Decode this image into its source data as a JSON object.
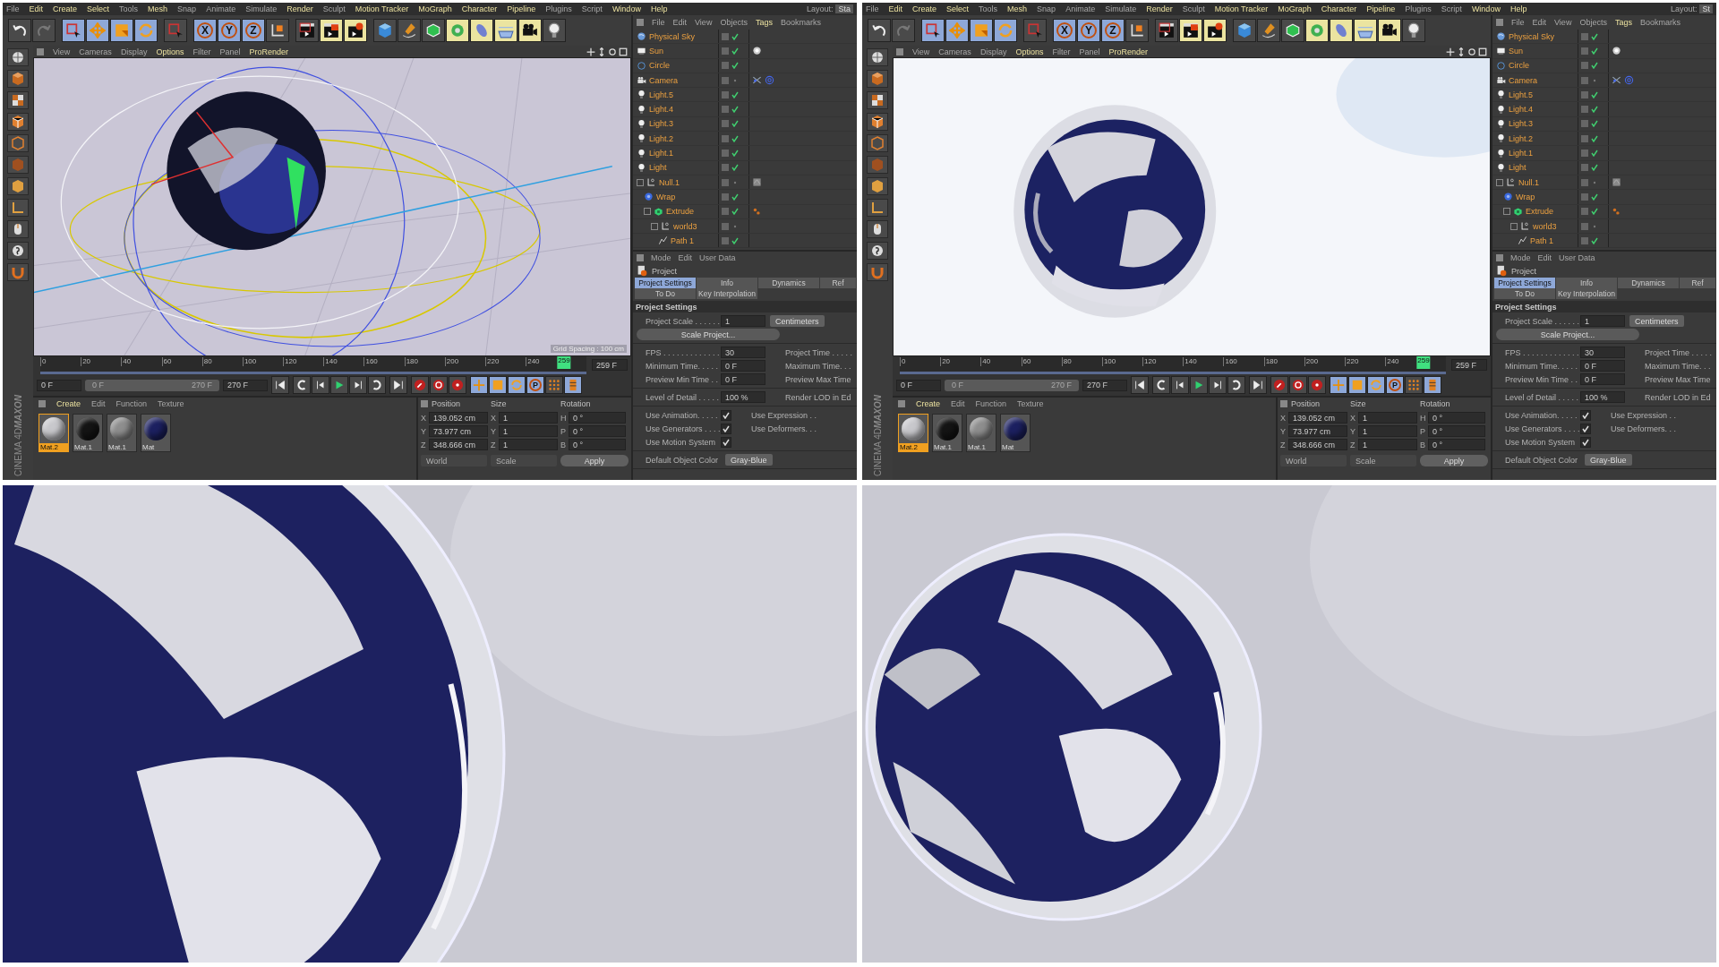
{
  "screens": [
    {
      "menu": [
        {
          "label": "File",
          "accent": false
        },
        {
          "label": "Edit",
          "accent": true
        },
        {
          "label": "Create",
          "accent": true
        },
        {
          "label": "Select",
          "accent": true
        },
        {
          "label": "Tools",
          "accent": false
        },
        {
          "label": "Mesh",
          "accent": true
        },
        {
          "label": "Snap",
          "accent": false
        },
        {
          "label": "Animate",
          "accent": false
        },
        {
          "label": "Simulate",
          "accent": false
        },
        {
          "label": "Render",
          "accent": true
        },
        {
          "label": "Sculpt",
          "accent": false
        },
        {
          "label": "Motion Tracker",
          "accent": true
        },
        {
          "label": "MoGraph",
          "accent": true
        },
        {
          "label": "Character",
          "accent": true
        },
        {
          "label": "Pipeline",
          "accent": true
        },
        {
          "label": "Plugins",
          "accent": false
        },
        {
          "label": "Script",
          "accent": false
        },
        {
          "label": "Window",
          "accent": true
        },
        {
          "label": "Help",
          "accent": true
        }
      ],
      "layout": {
        "label": "Layout:",
        "value": "Sta"
      },
      "axis_buttons": [
        "X",
        "Y",
        "Z"
      ],
      "viewport": {
        "kind": "wireframe",
        "grid_spacing": "Grid Spacing : 100 cm",
        "menu": [
          {
            "label": "View",
            "accent": false
          },
          {
            "label": "Cameras",
            "accent": false
          },
          {
            "label": "Display",
            "accent": false
          },
          {
            "label": "Options",
            "accent": true
          },
          {
            "label": "Filter",
            "accent": false
          },
          {
            "label": "Panel",
            "accent": false
          },
          {
            "label": "ProRender",
            "accent": true
          }
        ]
      },
      "timeline": {
        "ticks": [
          "0",
          "20",
          "40",
          "60",
          "80",
          "100",
          "120",
          "140",
          "160",
          "180",
          "200",
          "220",
          "240"
        ],
        "current": "259",
        "level": 0.959,
        "frame_field": "259 F"
      },
      "transport": {
        "start": "0 F",
        "range_start": "0 F",
        "range_end": "270 F",
        "end": "270 F",
        "key_button": "P",
        "level": 1
      },
      "materials": {
        "menu": [
          {
            "label": "Create",
            "accent": true
          },
          {
            "label": "Edit",
            "accent": false
          },
          {
            "label": "Function",
            "accent": false
          },
          {
            "label": "Texture",
            "accent": false
          }
        ],
        "items": [
          {
            "name": "Mat.2",
            "selected": true,
            "color": "#c8c8cc"
          },
          {
            "name": "Mat.1",
            "selected": false,
            "color": "#141414"
          },
          {
            "name": "Mat.1",
            "selected": false,
            "color": "#8e8e8e"
          },
          {
            "name": "Mat",
            "selected": false,
            "color": "#1c2060"
          }
        ]
      },
      "coords": {
        "headers": [
          "Position",
          "Size",
          "Rotation"
        ],
        "rows": [
          {
            "axis": "X",
            "position": "139.052 cm",
            "size_axis": "X",
            "size": "1",
            "rot_axis": "H",
            "rotation": "0 °"
          },
          {
            "axis": "Y",
            "position": "73.977 cm",
            "size_axis": "Y",
            "size": "1",
            "rot_axis": "P",
            "rotation": "0 °"
          },
          {
            "axis": "Z",
            "position": "348.666 cm",
            "size_axis": "Z",
            "size": "1",
            "rot_axis": "B",
            "rotation": "0 °"
          }
        ],
        "dropdowns": [
          "World",
          "Scale"
        ],
        "apply": "Apply"
      },
      "brand": [
        "MAXON",
        "CINEMA 4D"
      ],
      "objects": {
        "menu": [
          {
            "label": "File",
            "accent": false
          },
          {
            "label": "Edit",
            "accent": false
          },
          {
            "label": "View",
            "accent": false
          },
          {
            "label": "Objects",
            "accent": false
          },
          {
            "label": "Tags",
            "accent": true
          },
          {
            "label": "Bookmarks",
            "accent": false
          }
        ],
        "tree": [
          {
            "name": "Physical Sky",
            "kind": "sky",
            "checked": true
          },
          {
            "name": "Sun",
            "kind": "sun",
            "checked": true,
            "tags": [
              {
                "kind": "sun"
              }
            ]
          },
          {
            "name": "Circle",
            "kind": "circle",
            "checked": true
          },
          {
            "name": "Camera",
            "kind": "camera",
            "checked": false,
            "tags": [
              {
                "kind": "protection"
              },
              {
                "kind": "target"
              }
            ]
          },
          {
            "name": "Light.5",
            "kind": "light",
            "checked": true
          },
          {
            "name": "Light.4",
            "kind": "light",
            "checked": true
          },
          {
            "name": "Light.3",
            "kind": "light",
            "checked": true
          },
          {
            "name": "Light.2",
            "kind": "light",
            "checked": true
          },
          {
            "name": "Light.1",
            "kind": "light",
            "checked": true
          },
          {
            "name": "Light",
            "kind": "light",
            "checked": true
          },
          {
            "name": "Null.1",
            "kind": "null",
            "checked": false,
            "tags": [
              {
                "kind": "texture"
              }
            ],
            "children": [
              {
                "name": "Wrap",
                "kind": "wrap",
                "checked": true
              },
              {
                "name": "Extrude",
                "kind": "extrude",
                "checked": true,
                "tags": [
                  {
                    "kind": "dots"
                  }
                ],
                "children": [
                  {
                    "name": "world3",
                    "kind": "null",
                    "checked": false,
                    "children": [
                      {
                        "name": "Path 1",
                        "kind": "spline",
                        "checked": true
                      }
                    ]
                  }
                ]
              }
            ]
          }
        ]
      },
      "attributes": {
        "menu": [
          "Mode",
          "Edit",
          "User Data"
        ],
        "title": "Project",
        "tabs": [
          [
            {
              "label": "Project Settings",
              "selected": true
            },
            {
              "label": "Info",
              "selected": false
            },
            {
              "label": "Dynamics",
              "selected": false
            },
            {
              "label": "Ref",
              "selected": false
            }
          ],
          [
            {
              "label": "To Do",
              "selected": false
            },
            {
              "label": "Key Interpolation",
              "selected": false
            }
          ]
        ],
        "section": "Project Settings",
        "groups": [
          [
            {
              "kind": "number",
              "label": "Project Scale . . . . . .",
              "value": "1",
              "dropdown": "Centimeters"
            },
            {
              "kind": "button",
              "label": "Scale Project..."
            }
          ],
          [
            {
              "kind": "number",
              "label": "FPS . . . . . . . . . . . . .",
              "value": "30",
              "right_label": "Project Time . . . . ."
            },
            {
              "kind": "number",
              "label": "Minimum Time. . . . .",
              "value": "0 F",
              "right_label": "Maximum Time. . ."
            },
            {
              "kind": "number",
              "label": "Preview Min Time . .",
              "value": "0 F",
              "right_label": "Preview Max Time"
            }
          ],
          [
            {
              "kind": "number",
              "label": "Level of Detail . . . . .",
              "value": "100 %",
              "right_label": "Render LOD in Ed"
            }
          ],
          [
            {
              "kind": "check",
              "label": "Use Animation. . . . .",
              "checked": true,
              "right_label": "Use Expression . ."
            },
            {
              "kind": "check",
              "label": "Use Generators . . . .",
              "checked": true,
              "right_label": "Use Deformers. . ."
            },
            {
              "kind": "check",
              "label": "Use Motion System",
              "checked": true
            }
          ],
          [
            {
              "kind": "dropdown",
              "label": "Default Object Color",
              "value": "Gray-Blue"
            }
          ]
        ]
      }
    },
    {
      "menu": [
        {
          "label": "File",
          "accent": false
        },
        {
          "label": "Edit",
          "accent": true
        },
        {
          "label": "Create",
          "accent": true
        },
        {
          "label": "Select",
          "accent": true
        },
        {
          "label": "Tools",
          "accent": false
        },
        {
          "label": "Mesh",
          "accent": true
        },
        {
          "label": "Snap",
          "accent": false
        },
        {
          "label": "Animate",
          "accent": false
        },
        {
          "label": "Simulate",
          "accent": false
        },
        {
          "label": "Render",
          "accent": true
        },
        {
          "label": "Sculpt",
          "accent": false
        },
        {
          "label": "Motion Tracker",
          "accent": true
        },
        {
          "label": "MoGraph",
          "accent": true
        },
        {
          "label": "Character",
          "accent": true
        },
        {
          "label": "Pipeline",
          "accent": true
        },
        {
          "label": "Plugins",
          "accent": false
        },
        {
          "label": "Script",
          "accent": false
        },
        {
          "label": "Window",
          "accent": true
        },
        {
          "label": "Help",
          "accent": true
        }
      ],
      "layout": {
        "label": "Layout:",
        "value": "St"
      },
      "axis_buttons": [
        "X",
        "Y",
        "Z"
      ],
      "viewport": {
        "kind": "render",
        "menu": [
          {
            "label": "View",
            "accent": false
          },
          {
            "label": "Cameras",
            "accent": false
          },
          {
            "label": "Display",
            "accent": false
          },
          {
            "label": "Options",
            "accent": true
          },
          {
            "label": "Filter",
            "accent": false
          },
          {
            "label": "Panel",
            "accent": false
          },
          {
            "label": "ProRender",
            "accent": true
          }
        ]
      },
      "timeline": {
        "ticks": [
          "0",
          "20",
          "40",
          "60",
          "80",
          "100",
          "120",
          "140",
          "160",
          "180",
          "200",
          "220",
          "240"
        ],
        "current": "259",
        "level": 0.959,
        "frame_field": "259 F"
      },
      "transport": {
        "start": "0 F",
        "range_start": "0 F",
        "range_end": "270 F",
        "end": "270 F",
        "key_button": "P",
        "level": 1
      },
      "materials": {
        "menu": [
          {
            "label": "Create",
            "accent": true
          },
          {
            "label": "Edit",
            "accent": false
          },
          {
            "label": "Function",
            "accent": false
          },
          {
            "label": "Texture",
            "accent": false
          }
        ],
        "items": [
          {
            "name": "Mat.2",
            "selected": true,
            "color": "#c8c8cc"
          },
          {
            "name": "Mat.1",
            "selected": false,
            "color": "#141414"
          },
          {
            "name": "Mat.1",
            "selected": false,
            "color": "#8e8e8e"
          },
          {
            "name": "Mat",
            "selected": false,
            "color": "#1c2060"
          }
        ]
      },
      "coords": {
        "headers": [
          "Position",
          "Size",
          "Rotation"
        ],
        "rows": [
          {
            "axis": "X",
            "position": "139.052 cm",
            "size_axis": "X",
            "size": "1",
            "rot_axis": "H",
            "rotation": "0 °"
          },
          {
            "axis": "Y",
            "position": "73.977 cm",
            "size_axis": "Y",
            "size": "1",
            "rot_axis": "P",
            "rotation": "0 °"
          },
          {
            "axis": "Z",
            "position": "348.666 cm",
            "size_axis": "Z",
            "size": "1",
            "rot_axis": "B",
            "rotation": "0 °"
          }
        ],
        "dropdowns": [
          "World",
          "Scale"
        ],
        "apply": "Apply"
      },
      "brand": [
        "MAXON",
        "CINEMA 4D"
      ],
      "objects": {
        "menu": [
          {
            "label": "File",
            "accent": false
          },
          {
            "label": "Edit",
            "accent": false
          },
          {
            "label": "View",
            "accent": false
          },
          {
            "label": "Objects",
            "accent": false
          },
          {
            "label": "Tags",
            "accent": true
          },
          {
            "label": "Bookmarks",
            "accent": false
          }
        ],
        "tree": [
          {
            "name": "Physical Sky",
            "kind": "sky",
            "checked": true
          },
          {
            "name": "Sun",
            "kind": "sun",
            "checked": true,
            "tags": [
              {
                "kind": "sun"
              }
            ]
          },
          {
            "name": "Circle",
            "kind": "circle",
            "checked": true
          },
          {
            "name": "Camera",
            "kind": "camera",
            "checked": false,
            "tags": [
              {
                "kind": "protection"
              },
              {
                "kind": "target"
              }
            ]
          },
          {
            "name": "Light.5",
            "kind": "light",
            "checked": true
          },
          {
            "name": "Light.4",
            "kind": "light",
            "checked": true
          },
          {
            "name": "Light.3",
            "kind": "light",
            "checked": true
          },
          {
            "name": "Light.2",
            "kind": "light",
            "checked": true
          },
          {
            "name": "Light.1",
            "kind": "light",
            "checked": true
          },
          {
            "name": "Light",
            "kind": "light",
            "checked": true
          },
          {
            "name": "Null.1",
            "kind": "null",
            "checked": false,
            "tags": [
              {
                "kind": "texture"
              }
            ],
            "children": [
              {
                "name": "Wrap",
                "kind": "wrap",
                "checked": true
              },
              {
                "name": "Extrude",
                "kind": "extrude",
                "checked": true,
                "tags": [
                  {
                    "kind": "dots"
                  }
                ],
                "children": [
                  {
                    "name": "world3",
                    "kind": "null",
                    "checked": false,
                    "children": [
                      {
                        "name": "Path 1",
                        "kind": "spline",
                        "checked": true
                      }
                    ]
                  }
                ]
              }
            ]
          }
        ]
      },
      "attributes": {
        "menu": [
          "Mode",
          "Edit",
          "User Data"
        ],
        "title": "Project",
        "tabs": [
          [
            {
              "label": "Project Settings",
              "selected": true
            },
            {
              "label": "Info",
              "selected": false
            },
            {
              "label": "Dynamics",
              "selected": false
            },
            {
              "label": "Ref",
              "selected": false
            }
          ],
          [
            {
              "label": "To Do",
              "selected": false
            },
            {
              "label": "Key Interpolation",
              "selected": false
            }
          ]
        ],
        "section": "Project Settings",
        "groups": [
          [
            {
              "kind": "number",
              "label": "Project Scale . . . . . .",
              "value": "1",
              "dropdown": "Centimeters"
            },
            {
              "kind": "button",
              "label": "Scale Project..."
            }
          ],
          [
            {
              "kind": "number",
              "label": "FPS . . . . . . . . . . . . .",
              "value": "30",
              "right_label": "Project Time . . . . ."
            },
            {
              "kind": "number",
              "label": "Minimum Time. . . . .",
              "value": "0 F",
              "right_label": "Maximum Time. . ."
            },
            {
              "kind": "number",
              "label": "Preview Min Time . .",
              "value": "0 F",
              "right_label": "Preview Max Time"
            }
          ],
          [
            {
              "kind": "number",
              "label": "Level of Detail . . . . .",
              "value": "100 %",
              "right_label": "Render LOD in Ed"
            }
          ],
          [
            {
              "kind": "check",
              "label": "Use Animation. . . . .",
              "checked": true,
              "right_label": "Use Expression . ."
            },
            {
              "kind": "check",
              "label": "Use Generators . . . .",
              "checked": true,
              "right_label": "Use Deformers. . ."
            },
            {
              "kind": "check",
              "label": "Use Motion System",
              "checked": true
            }
          ],
          [
            {
              "kind": "dropdown",
              "label": "Default Object Color",
              "value": "Gray-Blue"
            }
          ]
        ]
      }
    }
  ]
}
